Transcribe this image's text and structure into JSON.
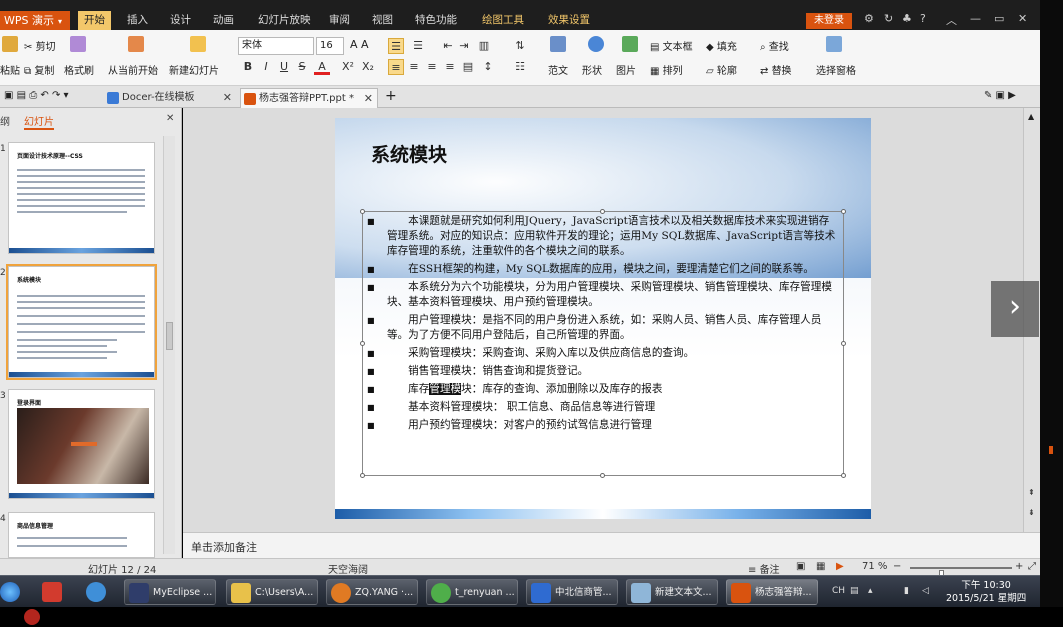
{
  "app": {
    "name": "WPS 演示",
    "login_label": "未登录"
  },
  "menu": [
    "开始",
    "插入",
    "设计",
    "动画",
    "幻灯片放映",
    "审阅",
    "视图",
    "特色功能",
    "绘图工具",
    "效果设置"
  ],
  "ribbon": {
    "paste": "粘贴",
    "cut": "剪切",
    "copy": "复制",
    "format_painter": "格式刷",
    "from_current": "从当前开始",
    "new_slide": "新建幻灯片",
    "font_name": "宋体",
    "font_size": "16",
    "bold": "B",
    "italic": "I",
    "underline": "U",
    "strike": "S",
    "font_color": "A",
    "superscript": "X²",
    "subscript": "X₂",
    "template": "范文",
    "shape": "形状",
    "picture": "图片",
    "textbox": "文本框",
    "arrange": "排列",
    "fill": "填充",
    "outline": "轮廓",
    "find": "查找",
    "replace": "替换",
    "select_pane": "选择窗格"
  },
  "tabs": [
    {
      "label": "Docer-在线模板"
    },
    {
      "label": "杨志强答辩PPT.ppt *"
    }
  ],
  "left_pane": {
    "tab_outline": "纲",
    "tab_slides": "幻灯片",
    "thumbs": [
      {
        "num": "1",
        "title": "页面设计技术原理--CSS"
      },
      {
        "num": "2",
        "title": "系统模块"
      },
      {
        "num": "3",
        "title": "登录界面"
      },
      {
        "num": "4",
        "title": "商品信息管理"
      }
    ]
  },
  "slide": {
    "title": "系统模块",
    "bullets": [
      "　　本课题就是研究如何利用JQuery，JavaScript语言技术以及相关数据库技术来实现进销存管理系统。对应的知识点：应用软件开发的理论；运用My SQL数据库、JavaScript语言等技术库存管理的系统，注重软件的各个模块之间的联系。",
      "　　在SSH框架的构建，My SQL数据库的应用，模块之间，要理清楚它们之间的联系等。",
      "　　本系统分为六个功能模块，分为用户管理模块、采购管理模块、销售管理模块、库存管理模块、基本资料管理模块、用户预约管理模块。",
      "　　用户管理模块：是指不同的用户身份进入系统，如：采购人员、销售人员、库存管理人员等。为了方便不同用户登陆后，自己所管理的界面。",
      "　　采购管理模块：采购查询、采购入库以及供应商信息的查询。",
      "　　销售管理模块：销售查询和提货登记。",
      "　　基本资料管理模块： 职工信息、商品信息等进行管理",
      "　　用户预约管理模块：对客户的预约试驾信息进行管理"
    ],
    "bullet_inventory": {
      "prefix": "　　库存",
      "highlight": "管理模",
      "suffix": "块：库存的查询、添加删除以及库存的报表"
    }
  },
  "notes": {
    "placeholder": "单击添加备注"
  },
  "status": {
    "slide_counter": "幻灯片 12 / 24",
    "theme": "天空海阔",
    "notes_btn": "备注",
    "zoom": "71 %",
    "zoom_level": 0.31
  },
  "taskbar": {
    "items": [
      "MyEclipse ...",
      "C:\\Users\\A...",
      "ZQ.YANG ·...",
      "t_renyuan ...",
      "中北信商管...",
      "新建文本文...",
      "杨志强答辩..."
    ],
    "time": "下午 10:30",
    "date": "2015/5/21 星期四",
    "tray_lang": "CH"
  },
  "colors": {
    "accent": "#d9530f",
    "selection": "#f0a33c"
  }
}
